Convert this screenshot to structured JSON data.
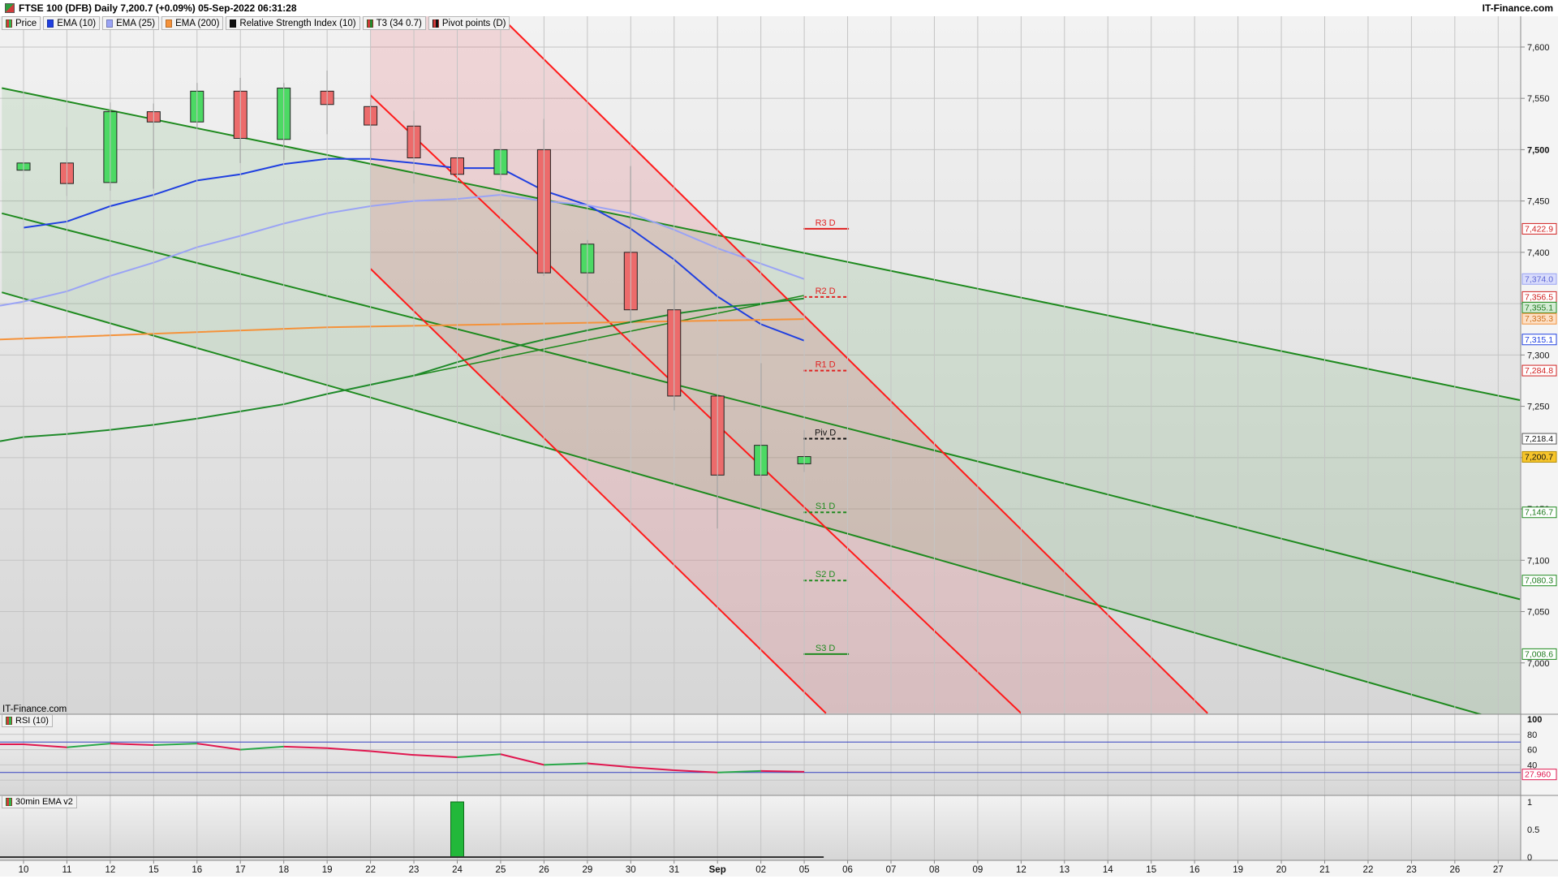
{
  "header": {
    "title": "FTSE 100 (DFB) Daily 7,200.7 (+0.09%) 05-Sep-2022 06:31:28",
    "brand": "IT-Finance.com"
  },
  "legend": [
    {
      "label": "Price",
      "color": "#32b34a"
    },
    {
      "label": "EMA (10)",
      "color": "#1f3fe0"
    },
    {
      "label": "EMA (25)",
      "color": "#9aa3f5"
    },
    {
      "label": "EMA (200)",
      "color": "#f5923a"
    },
    {
      "label": "Relative Strength Index (10)",
      "color": "#111111"
    },
    {
      "label": "T3 (34 0.7)",
      "color": "#1f8a2a"
    },
    {
      "label": "Pivot points (D)",
      "color": "#111111"
    }
  ],
  "watermark": "IT-Finance.com",
  "rsi_panel": {
    "label": "RSI (10)"
  },
  "ema30_panel": {
    "label": "30min EMA v2"
  },
  "colors": {
    "up": "#4cd964",
    "down": "#ec6b6b",
    "ema10": "#1f3fe0",
    "ema25": "#9aa3f5",
    "ema200": "#f5923a",
    "t3": "#1f8a2a",
    "channel_red": "#ff1a1a",
    "channel_green": "#1e8a1e",
    "rsi_line": "#e0174f",
    "rsi_line_up": "#2aa84a",
    "rsi_ref": "#3340c0"
  },
  "chart_data": [
    {
      "type": "candlestick",
      "title": "FTSE 100 (DFB) Daily",
      "x_tick_labels": [
        "10",
        "11",
        "12",
        "15",
        "16",
        "17",
        "18",
        "19",
        "22",
        "23",
        "24",
        "25",
        "26",
        "29",
        "30",
        "31",
        "Sep",
        "02",
        "05",
        "06",
        "07",
        "08",
        "09",
        "12",
        "13",
        "14",
        "15",
        "16",
        "19",
        "20",
        "21",
        "22",
        "23",
        "26",
        "27"
      ],
      "ylim": [
        6950,
        7630
      ],
      "y_ticks": [
        7000,
        7050,
        7100,
        7150,
        7200,
        7250,
        7300,
        7350,
        7400,
        7450,
        7500,
        7550,
        7600
      ],
      "y_tick_labels": [
        "7,000",
        "7,050",
        "7,100",
        "7,150",
        "7,200",
        "7,250",
        "7,300",
        "7,350",
        "7,400",
        "7,450",
        "7,500",
        "7,550",
        "7,600"
      ],
      "candles": [
        {
          "date": "10",
          "open": 7480,
          "high": 7522,
          "low": 7465,
          "close": 7487
        },
        {
          "date": "11",
          "open": 7487,
          "high": 7522,
          "low": 7455,
          "close": 7467
        },
        {
          "date": "12",
          "open": 7468,
          "high": 7546,
          "low": 7460,
          "close": 7537
        },
        {
          "date": "15",
          "open": 7537,
          "high": 7545,
          "low": 7462,
          "close": 7527
        },
        {
          "date": "16",
          "open": 7527,
          "high": 7565,
          "low": 7520,
          "close": 7557
        },
        {
          "date": "17",
          "open": 7557,
          "high": 7570,
          "low": 7487,
          "close": 7511
        },
        {
          "date": "18",
          "open": 7510,
          "high": 7565,
          "low": 7490,
          "close": 7560
        },
        {
          "date": "19",
          "open": 7557,
          "high": 7577,
          "low": 7515,
          "close": 7544
        },
        {
          "date": "22",
          "open": 7542,
          "high": 7555,
          "low": 7489,
          "close": 7524
        },
        {
          "date": "23",
          "open": 7523,
          "high": 7538,
          "low": 7467,
          "close": 7492
        },
        {
          "date": "24",
          "open": 7492,
          "high": 7495,
          "low": 7409,
          "close": 7476
        },
        {
          "date": "25",
          "open": 7476,
          "high": 7538,
          "low": 7470,
          "close": 7500
        },
        {
          "date": "26",
          "open": 7500,
          "high": 7530,
          "low": 7377,
          "close": 7380
        },
        {
          "date": "29",
          "open": 7380,
          "high": 7412,
          "low": 7347,
          "close": 7408
        },
        {
          "date": "30",
          "open": 7400,
          "high": 7484,
          "low": 7332,
          "close": 7344
        },
        {
          "date": "31",
          "open": 7344,
          "high": 7388,
          "low": 7246,
          "close": 7260
        },
        {
          "date": "Sep",
          "open": 7260,
          "high": 7260,
          "low": 7131,
          "close": 7183
        },
        {
          "date": "02",
          "open": 7183,
          "high": 7292,
          "low": 7150,
          "close": 7212
        },
        {
          "date": "05",
          "open": 7194,
          "high": 7227,
          "low": 7186,
          "close": 7201
        }
      ],
      "series": [
        {
          "name": "EMA (10)",
          "x": [
            "10",
            "11",
            "12",
            "15",
            "16",
            "17",
            "18",
            "19",
            "22",
            "23",
            "24",
            "25",
            "26",
            "29",
            "30",
            "31",
            "Sep",
            "02",
            "05"
          ],
          "values": [
            7424,
            7430,
            7445,
            7456,
            7470,
            7476,
            7486,
            7491,
            7491,
            7487,
            7482,
            7482,
            7460,
            7446,
            7423,
            7393,
            7357,
            7330,
            7314
          ]
        },
        {
          "name": "EMA (25)",
          "x": [
            "10",
            "11",
            "12",
            "15",
            "16",
            "17",
            "18",
            "19",
            "22",
            "23",
            "24",
            "25",
            "26",
            "29",
            "30",
            "31",
            "Sep",
            "02",
            "05"
          ],
          "values": [
            7352,
            7362,
            7377,
            7390,
            7405,
            7416,
            7428,
            7438,
            7445,
            7450,
            7452,
            7456,
            7450,
            7446,
            7438,
            7422,
            7404,
            7389,
            7374
          ]
        },
        {
          "name": "EMA (200)",
          "x": [
            "10",
            "19",
            "05"
          ],
          "values": [
            7315,
            7327,
            7335
          ]
        },
        {
          "name": "T3 (34 0.7)",
          "x": [
            "10",
            "11",
            "12",
            "15",
            "16",
            "17",
            "18",
            "19",
            "22",
            "23",
            "24",
            "25",
            "26",
            "29",
            "30",
            "31",
            "Sep",
            "02",
            "05"
          ],
          "values": [
            7220,
            7223,
            7227,
            7232,
            7238,
            7245,
            7252,
            7262,
            7271,
            7280,
            7293,
            7305,
            7315,
            7324,
            7332,
            7340,
            7346,
            7350,
            7355
          ]
        }
      ],
      "pivots": [
        {
          "label": "R3 D",
          "value": 7422.9,
          "kind": "r"
        },
        {
          "label": "R2 D",
          "value": 7356.5,
          "kind": "r"
        },
        {
          "label": "R1 D",
          "value": 7284.8,
          "kind": "r"
        },
        {
          "label": "Piv D",
          "value": 7218.4,
          "kind": "p"
        },
        {
          "label": "S1 D",
          "value": 7146.7,
          "kind": "s"
        },
        {
          "label": "S2 D",
          "value": 7080.3,
          "kind": "s"
        },
        {
          "label": "S3 D",
          "value": 7008.6,
          "kind": "s"
        }
      ],
      "price_tags": [
        {
          "text": "7,422.9",
          "value": 7422.9,
          "bg": "#ffffff",
          "fg": "#d02020",
          "border": "#d02020"
        },
        {
          "text": "7,374.0",
          "value": 7374.0,
          "bg": "#d9dcfb",
          "fg": "#5d66d6",
          "border": "#9aa3f5"
        },
        {
          "text": "7,356.5",
          "value": 7356.5,
          "bg": "#ffffff",
          "fg": "#d02020",
          "border": "#d02020"
        },
        {
          "text": "7,355.1",
          "value": 7355.1,
          "bg": "#d5ecd5",
          "fg": "#1e7a1e",
          "border": "#1e8a1e"
        },
        {
          "text": "7,335.3",
          "value": 7335.3,
          "bg": "#fde0c6",
          "fg": "#d0701a",
          "border": "#f5923a"
        },
        {
          "text": "7,315.1",
          "value": 7315.1,
          "bg": "#ffffff",
          "fg": "#1f3fe0",
          "border": "#1f3fe0"
        },
        {
          "text": "7,284.8",
          "value": 7284.8,
          "bg": "#ffffff",
          "fg": "#d02020",
          "border": "#d02020"
        },
        {
          "text": "7,218.4",
          "value": 7218.4,
          "bg": "#ffffff",
          "fg": "#111111",
          "border": "#555555"
        },
        {
          "text": "7,200.7",
          "value": 7200.7,
          "bg": "#f7c52b",
          "fg": "#111111",
          "border": "#b38b00"
        },
        {
          "text": "7,146.7",
          "value": 7146.7,
          "bg": "#ffffff",
          "fg": "#1e7a1e",
          "border": "#1e8a1e"
        },
        {
          "text": "7,080.3",
          "value": 7080.3,
          "bg": "#ffffff",
          "fg": "#1e7a1e",
          "border": "#1e8a1e"
        },
        {
          "text": "7,008.6",
          "value": 7008.6,
          "bg": "#ffffff",
          "fg": "#1e7a1e",
          "border": "#1e8a1e"
        }
      ],
      "channels": {
        "green_upper": [
          {
            "x": -0.5,
            "y": 7560
          },
          {
            "x": 34.5,
            "y": 7256
          }
        ],
        "green_mid": [
          {
            "x": -0.5,
            "y": 7438
          },
          {
            "x": 34.5,
            "y": 7062
          }
        ],
        "green_lower": [
          {
            "x": -0.5,
            "y": 7361
          },
          {
            "x": 34.5,
            "y": 6939
          }
        ],
        "green_up_short": [
          {
            "x": 8,
            "y": 7271
          },
          {
            "x": 18,
            "y": 7358
          }
        ],
        "red_upper": [
          {
            "x": 10.8,
            "y": 7638
          },
          {
            "x": 27.3,
            "y": 6951
          }
        ],
        "red_mid": [
          {
            "x": 8,
            "y": 7553
          },
          {
            "x": 23,
            "y": 6951
          }
        ],
        "red_lower": [
          {
            "x": 8,
            "y": 7384
          },
          {
            "x": 18.5,
            "y": 6951
          }
        ]
      },
      "grid": true
    },
    {
      "type": "line",
      "title": "RSI (10)",
      "ylim": [
        0,
        100
      ],
      "y_tick_labels": [
        "100",
        "80",
        "60",
        "40",
        "20"
      ],
      "reference_lines": [
        70,
        30
      ],
      "last_value_label": "27.960",
      "x": [
        "10",
        "11",
        "12",
        "15",
        "16",
        "17",
        "18",
        "19",
        "22",
        "23",
        "24",
        "25",
        "26",
        "29",
        "30",
        "31",
        "Sep",
        "02",
        "05"
      ],
      "values": [
        67,
        63,
        68,
        66,
        68,
        60,
        64,
        62,
        58,
        53,
        50,
        54,
        40,
        42,
        37,
        33,
        30,
        32,
        31
      ]
    },
    {
      "type": "bar",
      "title": "30min EMA v2",
      "ylim": [
        0,
        1
      ],
      "y_tick_labels": [
        "1",
        "0.5",
        "0"
      ],
      "bars": [
        {
          "date": "24",
          "value": 1
        }
      ]
    }
  ]
}
